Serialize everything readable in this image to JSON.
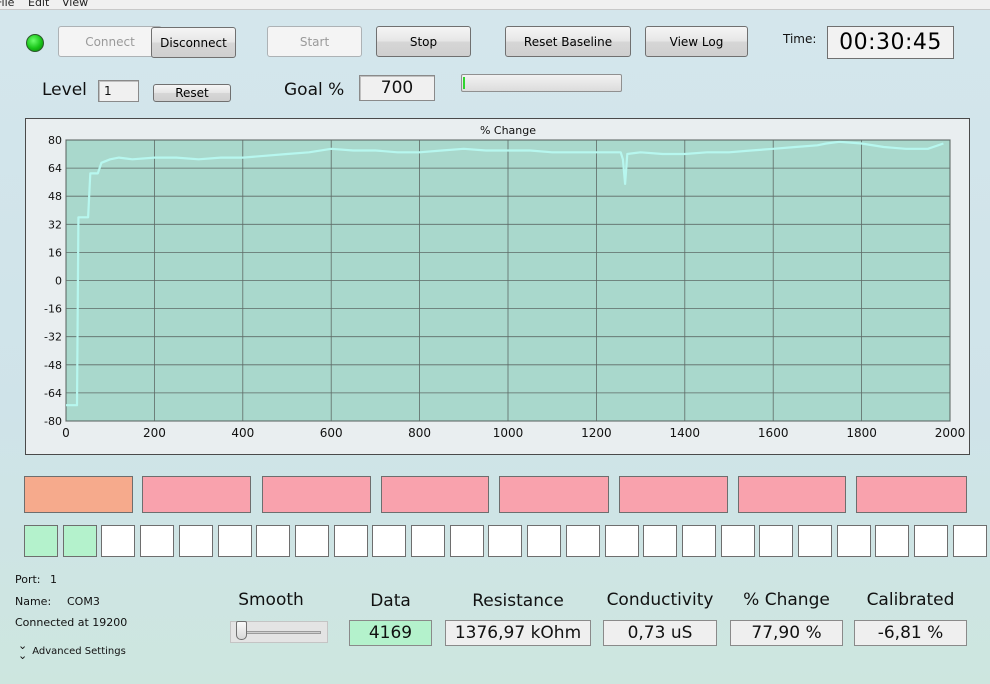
{
  "menu": {
    "items": [
      "File",
      "Edit",
      "View"
    ]
  },
  "toolbar": {
    "connect": "Connect",
    "disconnect": "Disconnect",
    "start": "Start",
    "stop": "Stop",
    "reset_baseline": "Reset Baseline",
    "view_log": "View Log",
    "time_label": "Time:",
    "time_value": "00:30:45"
  },
  "level": {
    "label": "Level",
    "value": "1",
    "reset": "Reset"
  },
  "goal": {
    "label": "Goal %",
    "value": "700",
    "progress": 0.01
  },
  "chart_data": {
    "type": "line",
    "title": "% Change",
    "xlim": [
      0,
      2000
    ],
    "ylim": [
      -80,
      80
    ],
    "xticks": [
      0,
      200,
      400,
      600,
      800,
      1000,
      1200,
      1400,
      1600,
      1800,
      2000
    ],
    "yticks": [
      80,
      64,
      48,
      32,
      16,
      0,
      -16,
      -32,
      -48,
      -64,
      -80
    ],
    "grid": true,
    "series": [
      {
        "values_x": [
          0,
          5,
          25,
          28,
          50,
          55,
          72,
          80,
          100,
          120,
          150,
          200,
          250,
          300,
          350,
          400,
          450,
          500,
          550,
          600,
          650,
          700,
          750,
          800,
          850,
          900,
          950,
          1000,
          1050,
          1100,
          1150,
          1200,
          1255,
          1260,
          1265,
          1270,
          1300,
          1350,
          1400,
          1450,
          1500,
          1550,
          1600,
          1650,
          1700,
          1720,
          1750,
          1800,
          1850,
          1900,
          1950,
          1985
        ],
        "values_y": [
          -71,
          -71,
          -71,
          36,
          36,
          61,
          61,
          67,
          69,
          70,
          69,
          70,
          70,
          69,
          70,
          70,
          71,
          72,
          73,
          75,
          74,
          74,
          73,
          73,
          74,
          75,
          74,
          74,
          74,
          73,
          73,
          73,
          73,
          69,
          55,
          72,
          73,
          72,
          72,
          73,
          73,
          74,
          75,
          76,
          77,
          78,
          79,
          78,
          76,
          75,
          75,
          78
        ],
        "color": "#b7f7ef"
      }
    ]
  },
  "level_blocks": [
    "#f6aa8c",
    "#f9a2ad",
    "#f9a2ad",
    "#f9a2ad",
    "#f9a2ad",
    "#f9a2ad",
    "#f9a2ad",
    "#f9a2ad"
  ],
  "level_cells_on": [
    true,
    true,
    false,
    false,
    false,
    false,
    false,
    false,
    false,
    false,
    false,
    false,
    false,
    false,
    false,
    false,
    false,
    false,
    false,
    false,
    false,
    false,
    false,
    false,
    false
  ],
  "status": {
    "port_label": "Port:",
    "port_value": "1",
    "name_label": "Name:",
    "name_value": "COM3",
    "connected": "Connected at 19200",
    "advanced": "Advanced Settings"
  },
  "smooth": {
    "label": "Smooth",
    "value": 0
  },
  "meters": {
    "data_label": "Data",
    "data_value": "4169",
    "resistance_label": "Resistance",
    "resistance_value": "1376,97 kOhm",
    "conductivity_label": "Conductivity",
    "conductivity_value": "0,73 uS",
    "change_label": "% Change",
    "change_value": "77,90 %",
    "calibrated_label": "Calibrated",
    "calibrated_value": "-6,81 %"
  }
}
